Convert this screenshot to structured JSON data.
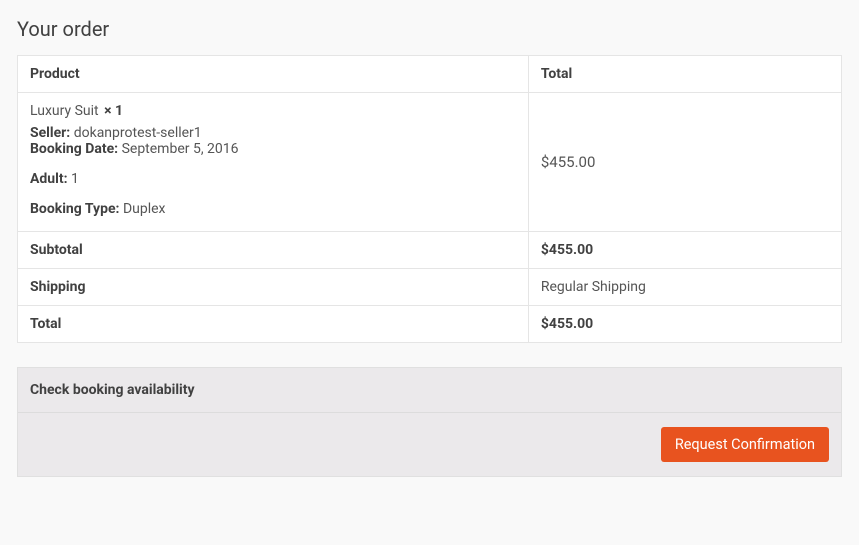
{
  "heading": "Your order",
  "table": {
    "headers": {
      "product": "Product",
      "total": "Total"
    },
    "item": {
      "name": "Luxury Suit",
      "qty": "× 1",
      "seller_label": "Seller:",
      "seller_value": "dokanprotest-seller1",
      "booking_date_label": "Booking Date:",
      "booking_date_value": "September 5, 2016",
      "adult_label": "Adult:",
      "adult_value": "1",
      "booking_type_label": "Booking Type:",
      "booking_type_value": "Duplex",
      "price": "$455.00"
    },
    "summary": {
      "subtotal_label": "Subtotal",
      "subtotal_value": "$455.00",
      "shipping_label": "Shipping",
      "shipping_value": "Regular Shipping",
      "total_label": "Total",
      "total_value": "$455.00"
    }
  },
  "availability": {
    "title": "Check booking availability",
    "button": "Request Confirmation"
  }
}
